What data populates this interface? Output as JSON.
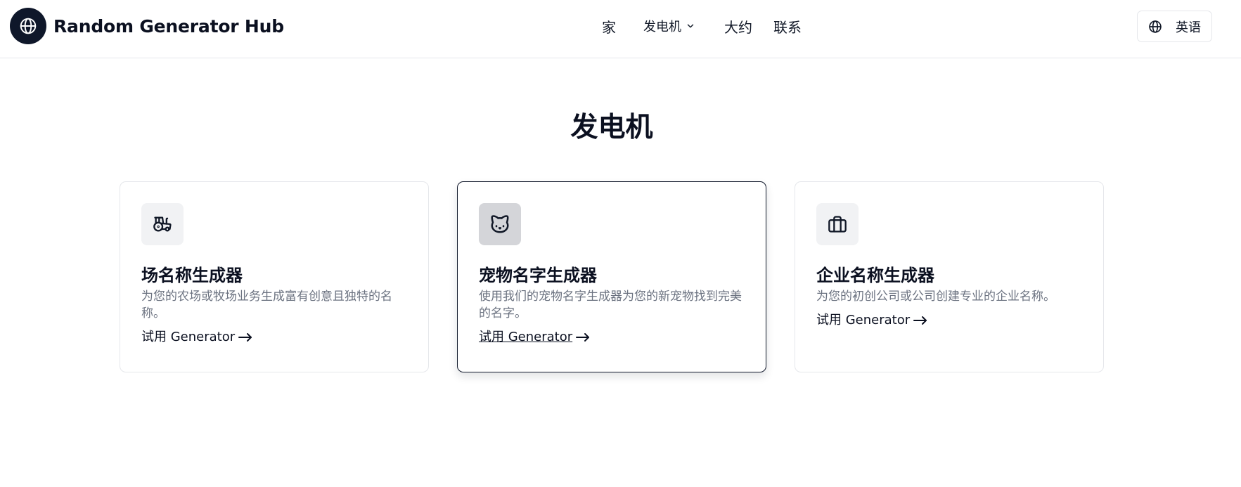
{
  "header": {
    "brand_name": "Random Generator Hub",
    "brand_icon": "globe-icon",
    "nav": [
      {
        "label": "家"
      },
      {
        "label": "发电机"
      },
      {
        "label": "大约"
      },
      {
        "label": "联系"
      }
    ],
    "language_label": "英语"
  },
  "main": {
    "title": "发电机",
    "cards": [
      {
        "icon": "tractor-icon",
        "title": "场名称生成器",
        "description": "为您的农场或牧场业务生成富有创意且独特的名称。",
        "link_label": "试用 Generator"
      },
      {
        "icon": "cat-icon",
        "title": "宠物名字生成器",
        "description": "使用我们的宠物名字生成器为您的新宠物找到完美的名字。",
        "link_label": "试用 Generator"
      },
      {
        "icon": "briefcase-icon",
        "title": "企业名称生成器",
        "description": "为您的初创公司或公司创建专业的企业名称。",
        "link_label": "试用 Generator"
      }
    ]
  },
  "colors": {
    "primary": "#0f172a",
    "muted_text": "#6b7280",
    "border": "#e5e7eb"
  }
}
